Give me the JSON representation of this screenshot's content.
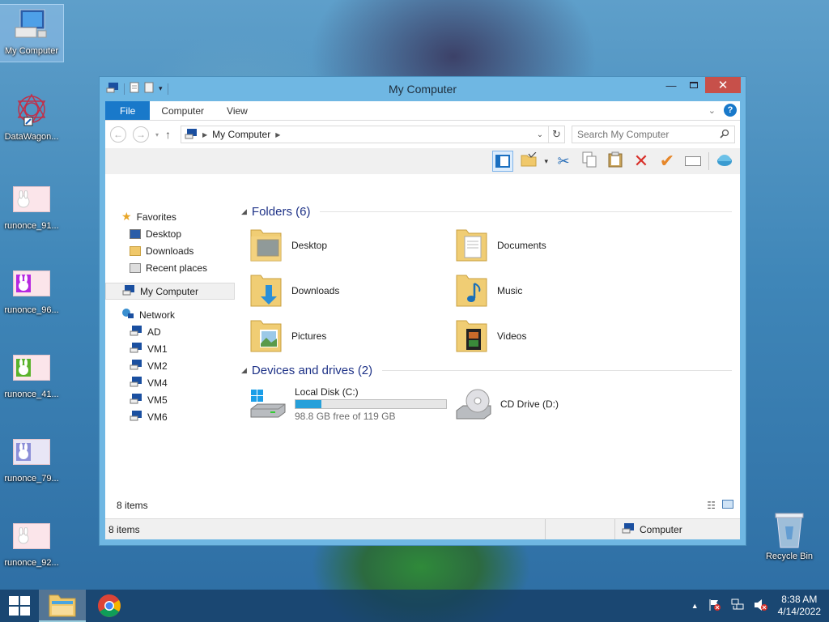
{
  "desktop": {
    "icons": [
      {
        "label": "My Computer",
        "icon": "computer-icon"
      },
      {
        "label": "DataWagon...",
        "icon": "datawagon-icon"
      },
      {
        "label": "runonce_91...",
        "icon": "image-file-icon"
      },
      {
        "label": "runonce_96...",
        "icon": "image-file-icon"
      },
      {
        "label": "runonce_41...",
        "icon": "image-file-icon"
      },
      {
        "label": "runonce_79...",
        "icon": "image-file-icon"
      },
      {
        "label": "runonce_92...",
        "icon": "image-file-icon"
      }
    ],
    "recycle_bin": "Recycle Bin"
  },
  "window": {
    "title": "My Computer",
    "tabs": {
      "file": "File",
      "computer": "Computer",
      "view": "View"
    },
    "address": "My Computer",
    "search_placeholder": "Search My Computer",
    "nav": {
      "favorites": "Favorites",
      "fav_items": [
        "Desktop",
        "Downloads",
        "Recent places"
      ],
      "my_computer": "My Computer",
      "network": "Network",
      "network_items": [
        "AD",
        "VM1",
        "VM2",
        "VM4",
        "VM5",
        "VM6"
      ]
    },
    "folders_header": "Folders (6)",
    "folders": [
      "Desktop",
      "Documents",
      "Downloads",
      "Music",
      "Pictures",
      "Videos"
    ],
    "devices_header": "Devices and drives (2)",
    "drives": {
      "local": {
        "name": "Local Disk (C:)",
        "free": "98.8 GB free of 119 GB",
        "used_fraction": 0.17
      },
      "cd": {
        "name": "CD Drive (D:)"
      }
    },
    "item_count": "8 items",
    "status_left": "8 items",
    "status_right": "Computer"
  },
  "taskbar": {
    "time": "8:38 AM",
    "date": "4/14/2022"
  },
  "colors": {
    "accent": "#1979ca",
    "close": "#c7504a",
    "bar_fill": "#26a0da",
    "section": "#1e3287"
  }
}
